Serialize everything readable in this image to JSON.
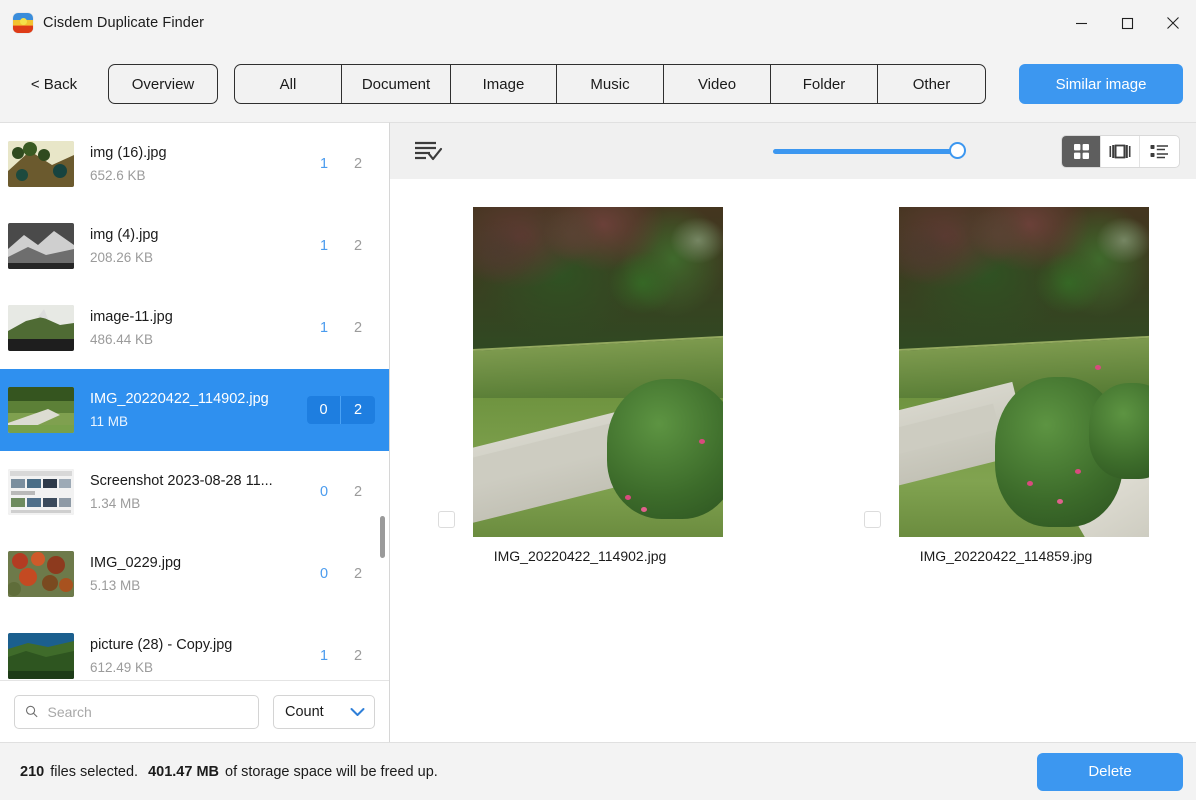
{
  "window": {
    "title": "Cisdem Duplicate Finder",
    "app_icon": "cisdem-app-icon",
    "controls": {
      "minimize": "minimize-icon",
      "maximize": "maximize-icon",
      "close": "close-icon"
    }
  },
  "toolbar": {
    "back_label": "< Back",
    "overview_label": "Overview",
    "tabs": [
      {
        "label": "All",
        "key": "all",
        "active": false
      },
      {
        "label": "Document",
        "key": "document",
        "active": false
      },
      {
        "label": "Image",
        "key": "image",
        "active": false
      },
      {
        "label": "Music",
        "key": "music",
        "active": false
      },
      {
        "label": "Video",
        "key": "video",
        "active": false
      },
      {
        "label": "Folder",
        "key": "folder",
        "active": false
      },
      {
        "label": "Other",
        "key": "other",
        "active": false
      }
    ],
    "similar_image_label": "Similar image",
    "accent_color": "#3c97f0"
  },
  "sidebar": {
    "files": [
      {
        "name": "img (16).jpg",
        "size": "652.6 KB",
        "selected_count": "1",
        "total_count": "2",
        "selected": false
      },
      {
        "name": "img (4).jpg",
        "size": "208.26 KB",
        "selected_count": "1",
        "total_count": "2",
        "selected": false
      },
      {
        "name": "image-11.jpg",
        "size": "486.44 KB",
        "selected_count": "1",
        "total_count": "2",
        "selected": false
      },
      {
        "name": "IMG_20220422_114902.jpg",
        "size": "11 MB",
        "selected_count": "0",
        "total_count": "2",
        "selected": true
      },
      {
        "name": "Screenshot 2023-08-28 11...",
        "size": "1.34 MB",
        "selected_count": "0",
        "total_count": "2",
        "selected": false
      },
      {
        "name": "IMG_0229.jpg",
        "size": "5.13 MB",
        "selected_count": "0",
        "total_count": "2",
        "selected": false
      },
      {
        "name": "picture (28) - Copy.jpg",
        "size": "612.49 KB",
        "selected_count": "1",
        "total_count": "2",
        "selected": false
      }
    ],
    "search": {
      "placeholder": "Search",
      "value": "",
      "icon": "search-icon"
    },
    "sort": {
      "label": "Count",
      "icon": "chevron-down-icon"
    }
  },
  "main": {
    "select_all_icon": "list-check-icon",
    "zoom_slider": {
      "value": 100,
      "min": 0,
      "max": 100
    },
    "view_modes": [
      {
        "key": "grid",
        "icon": "grid-view-icon",
        "active": true
      },
      {
        "key": "coverflow",
        "icon": "coverflow-view-icon",
        "active": false
      },
      {
        "key": "list",
        "icon": "list-view-icon",
        "active": false
      }
    ],
    "items": [
      {
        "caption": "IMG_20220422_114902.jpg",
        "checked": false
      },
      {
        "caption": "IMG_20220422_114859.jpg",
        "checked": false
      }
    ]
  },
  "status": {
    "count": "210",
    "count_suffix": "files selected.",
    "size": "401.47 MB",
    "size_suffix": "of storage space will be freed up.",
    "delete_label": "Delete"
  }
}
